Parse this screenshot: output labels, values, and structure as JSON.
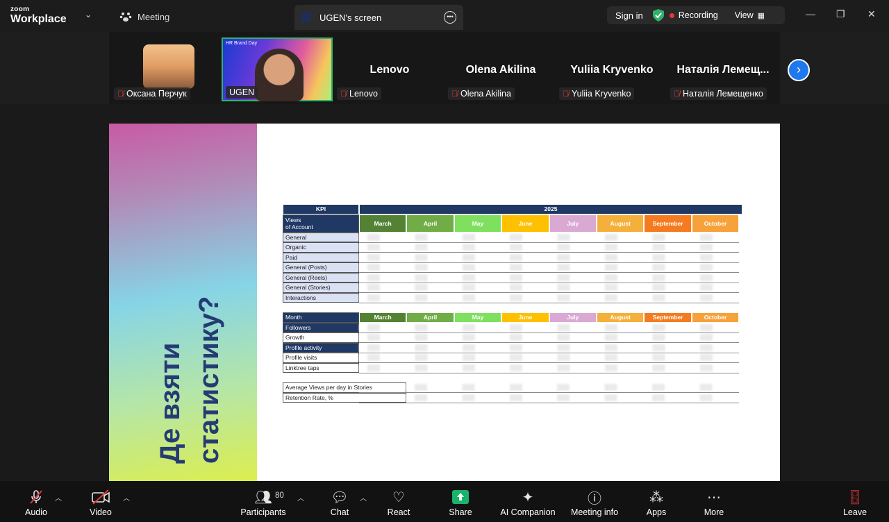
{
  "app": {
    "logo_top": "zoom",
    "logo_bottom": "Workplace",
    "meeting_tab": "Meeting",
    "screen_tab": "UGEN's screen"
  },
  "topbar": {
    "sign_in": "Sign in",
    "recording": "Recording",
    "view": "View"
  },
  "gallery": {
    "tiles": [
      {
        "name": "Оксана Перчук",
        "big": ""
      },
      {
        "name": "UGEN",
        "big": "",
        "overlay": "HR Brand Day"
      },
      {
        "name": "Lenovo",
        "big": "Lenovo"
      },
      {
        "name": "Olena Akilina",
        "big": "Olena Akilina"
      },
      {
        "name": "Yuliia Kryvenko",
        "big": "Yuliia Kryvenko"
      },
      {
        "name": "Наталія Лемещенко",
        "big": "Наталія Лемещ..."
      }
    ]
  },
  "slide": {
    "title_line1": "Де взяти",
    "title_line2": "статистику?",
    "table": {
      "kpi_header": "KPI",
      "year": "2025",
      "views_label": "Views\nof Account",
      "months": [
        "March",
        "April",
        "May",
        "June",
        "July",
        "August",
        "September",
        "October"
      ],
      "month_colors": [
        "#548235",
        "#70ad47",
        "#7fe05f",
        "#ffc000",
        "#d9a9d4",
        "#f4b03a",
        "#f47b20",
        "#f6a13a"
      ],
      "views_rows": [
        "General",
        "Organic",
        "Paid",
        "General (Posts)",
        "General (Reels)",
        "General (Stories)",
        "Interactions"
      ],
      "month_label": "Month",
      "growth_rows": [
        "Followers",
        "Growth",
        "Profile activity",
        "Profile visits",
        "Linktree taps"
      ],
      "extra_rows": [
        "Average Views per day in Stories",
        "Retention Rate, %"
      ]
    }
  },
  "toolbar": {
    "audio": "Audio",
    "video": "Video",
    "participants": "Participants",
    "participants_count": "80",
    "chat": "Chat",
    "react": "React",
    "share": "Share",
    "ai_companion": "AI Companion",
    "meeting_info": "Meeting info",
    "apps": "Apps",
    "more": "More",
    "leave": "Leave"
  }
}
